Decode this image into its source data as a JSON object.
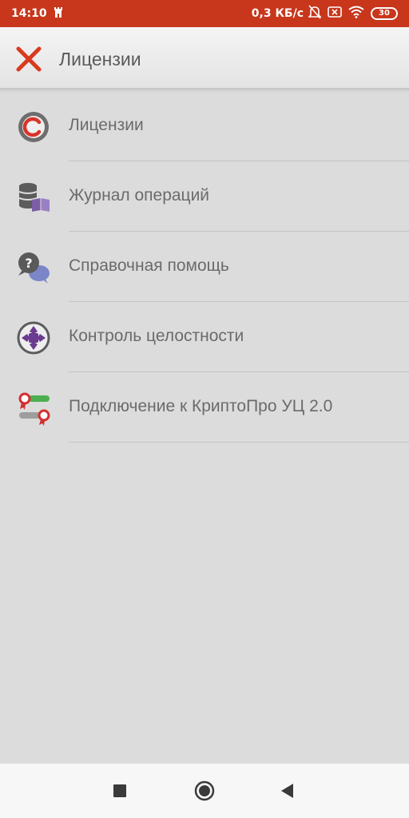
{
  "status_bar": {
    "time": "14:10",
    "net_speed": "0,3 КБ/с",
    "battery": "30",
    "notification_icon": "tower-icon",
    "icons": [
      "bell-off-icon",
      "sim-off-icon",
      "wifi-icon",
      "battery-icon"
    ]
  },
  "app_bar": {
    "title": "Лицензии",
    "close_icon": "close-icon",
    "accent_color": "#d93a1f"
  },
  "menu": {
    "items": [
      {
        "label": "Лицензии",
        "icon": "copyright-icon"
      },
      {
        "label": "Журнал операций",
        "icon": "database-book-icon"
      },
      {
        "label": "Справочная помощь",
        "icon": "help-chat-icon"
      },
      {
        "label": "Контроль целостности",
        "icon": "integrity-icon"
      },
      {
        "label": "Подключение к КриптоПро УЦ 2.0",
        "icon": "certificate-connect-icon"
      }
    ]
  },
  "nav_bar": {
    "buttons": [
      "recents-icon",
      "home-icon",
      "back-icon"
    ]
  },
  "colors": {
    "status_bar": "#c8361c",
    "background": "#dcdcdc",
    "text": "#6b6b6b"
  }
}
